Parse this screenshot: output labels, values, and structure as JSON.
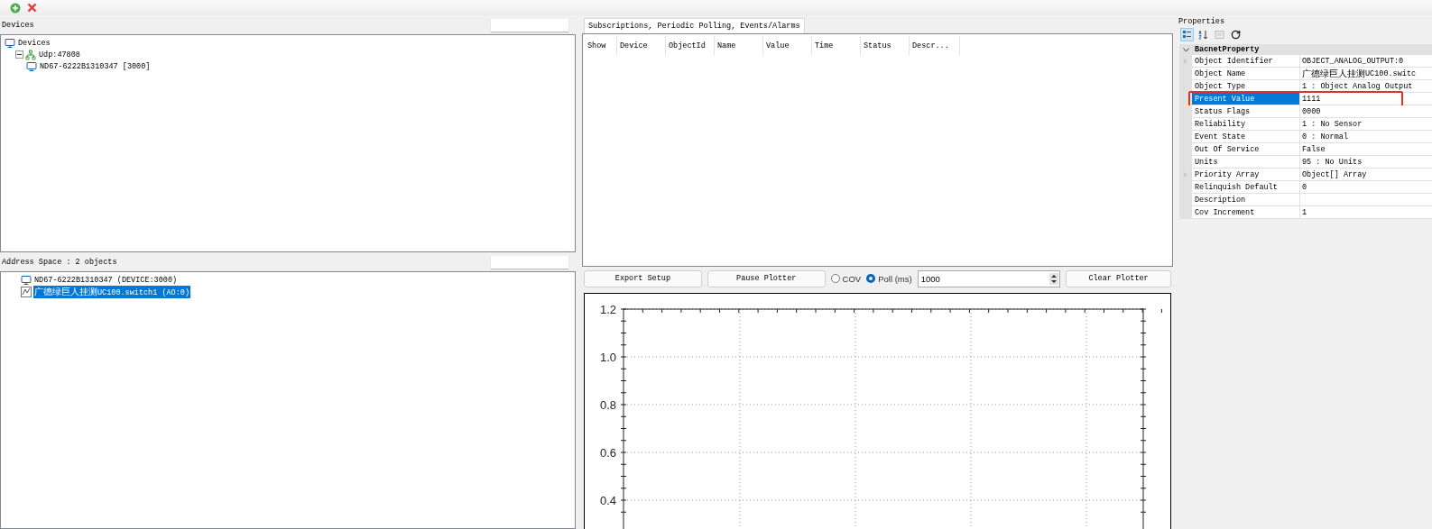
{
  "toolbar": [
    {
      "kind": "add"
    },
    {
      "kind": "remove"
    }
  ],
  "devices": {
    "title": "Devices",
    "tree": [
      {
        "label": "Devices",
        "kind": "computers",
        "children": [
          {
            "label": "Udp:47808",
            "kind": "network",
            "expanded": true,
            "children": [
              {
                "label": "ND67-6222B1310347 [3000]",
                "kind": "device"
              }
            ]
          }
        ]
      }
    ]
  },
  "address_space": {
    "title": "Address Space : 2 objects",
    "items": [
      {
        "label": "ND67-6222B1310347 (DEVICE:3000)",
        "kind": "device",
        "selected": false
      },
      {
        "label": "广德绿巨人挂测UC100.switch1 (AO:0)",
        "kind": "analog",
        "selected": true
      }
    ]
  },
  "subscriptions": {
    "tab": "Subscriptions, Periodic Polling, Events/Alarms",
    "columns": [
      "Show",
      "Device",
      "ObjectId",
      "Name",
      "Value",
      "Time",
      "Status",
      "Descr..."
    ]
  },
  "plotter": {
    "buttons": [
      "Export Setup",
      "Pause Plotter"
    ],
    "modes": [
      {
        "label": "COV",
        "selected": false
      },
      {
        "label": "Poll (ms)",
        "selected": true
      }
    ],
    "poll_value": "1000",
    "clear_button": "Clear Plotter",
    "y_tick_labels": [
      "1.2",
      "1.0",
      "0.8",
      "0.6",
      "0.4"
    ]
  },
  "properties": {
    "title": "Properties",
    "toolbar": [
      {
        "kind": "categorized",
        "selected": true
      },
      {
        "kind": "alphabetical",
        "selected": false
      },
      {
        "kind": "pages",
        "selected": false
      },
      {
        "kind": "refresh",
        "selected": false
      }
    ],
    "category": {
      "label": "BacnetProperty",
      "expanded": true
    },
    "rows": [
      {
        "name": "Object Identifier",
        "value": "OBJECT_ANALOG_OUTPUT:0",
        "expandable": true,
        "selected": false,
        "highlighted": false
      },
      {
        "name": "Object Name",
        "value": "广德绿巨人挂测UC100.switc",
        "expandable": false,
        "selected": false,
        "highlighted": false
      },
      {
        "name": "Object Type",
        "value": "1 : Object Analog Output",
        "expandable": false,
        "selected": false,
        "highlighted": false
      },
      {
        "name": "Present Value",
        "value": "1111",
        "expandable": false,
        "selected": true,
        "highlighted": true
      },
      {
        "name": "Status Flags",
        "value": "0000",
        "expandable": false,
        "selected": false,
        "highlighted": false
      },
      {
        "name": "Reliability",
        "value": "1 : No Sensor",
        "expandable": false,
        "selected": false,
        "highlighted": false
      },
      {
        "name": "Event State",
        "value": "0 : Normal",
        "expandable": false,
        "selected": false,
        "highlighted": false
      },
      {
        "name": "Out Of Service",
        "value": "False",
        "expandable": false,
        "selected": false,
        "highlighted": false
      },
      {
        "name": "Units",
        "value": "95 : No Units",
        "expandable": false,
        "selected": false,
        "highlighted": false
      },
      {
        "name": "Priority Array",
        "value": "Object[] Array",
        "expandable": true,
        "selected": false,
        "highlighted": false
      },
      {
        "name": "Relinquish Default",
        "value": "0",
        "expandable": false,
        "selected": false,
        "highlighted": false
      },
      {
        "name": "Description",
        "expandable": false,
        "selected": false,
        "highlighted": false
      },
      {
        "name": "Cov Increment",
        "value": "1",
        "expandable": false,
        "selected": false,
        "highlighted": false
      }
    ]
  }
}
